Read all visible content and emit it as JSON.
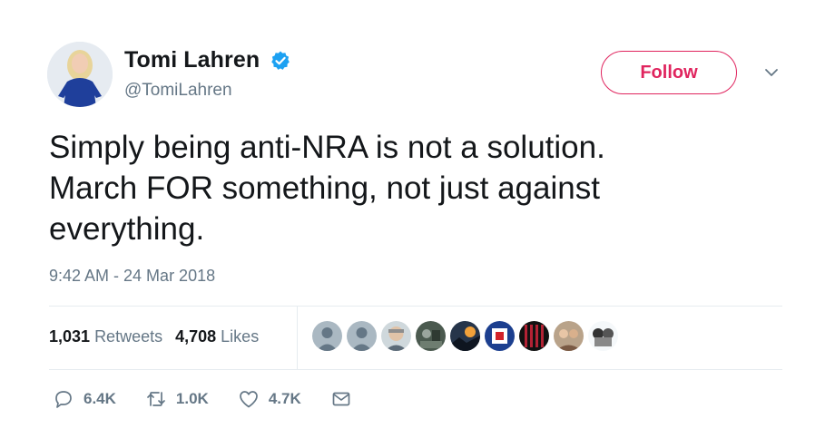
{
  "user": {
    "display_name": "Tomi Lahren",
    "handle": "@TomiLahren",
    "verified_icon": "verified-badge-icon"
  },
  "header": {
    "follow_label": "Follow",
    "menu_icon": "chevron-down-icon"
  },
  "tweet": {
    "text": "Simply being anti-NRA is not a solution.\nMarch FOR something, not just against\neverything.",
    "timestamp": "9:42 AM - 24 Mar 2018"
  },
  "stats": {
    "retweets_count": "1,031",
    "retweets_label": "Retweets",
    "likes_count": "4,708",
    "likes_label": "Likes"
  },
  "actions": {
    "replies": "6.4K",
    "retweets": "1.0K",
    "likes": "4.7K"
  },
  "colors": {
    "follow_red": "#e0245e",
    "verified_blue": "#1da1f2",
    "muted_text": "#657786",
    "main_text": "#14171a"
  }
}
